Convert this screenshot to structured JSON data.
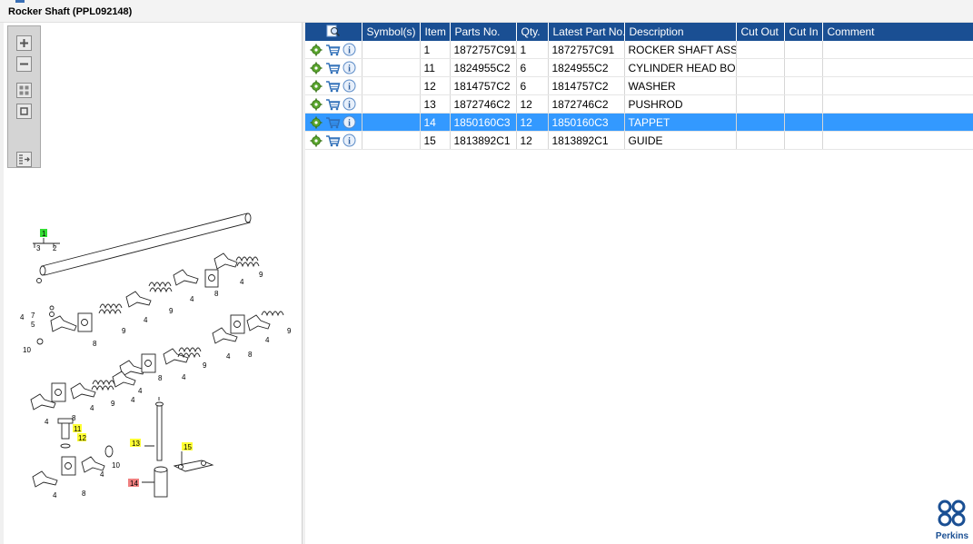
{
  "window": {
    "title": "Rocker Shaft (PPL092148)"
  },
  "viewer_toolbar": {
    "buttons": [
      {
        "icon": "zoom-in-icon"
      },
      {
        "icon": "zoom-out-icon"
      },
      {
        "icon": "fit-page-icon"
      },
      {
        "icon": "actual-size-icon"
      },
      {
        "icon": "export-icon"
      }
    ]
  },
  "diagram": {
    "callouts": {
      "c1": "1",
      "c2": "2",
      "c3": "3",
      "c4": "4",
      "c5": "5",
      "c7": "7",
      "c8": "8",
      "c9": "9",
      "c10": "10",
      "c11": "11",
      "c12": "12",
      "c13": "13",
      "c14": "14",
      "c15": "15"
    },
    "highlight_colors": {
      "selected": "#f08080",
      "item": "#ffff33",
      "group": "#33dd33"
    }
  },
  "table": {
    "headers": [
      "Symbol(s)",
      "Item",
      "Parts No.",
      "Qty.",
      "Latest Part No.",
      "Description",
      "Cut Out",
      "Cut In",
      "Comment"
    ],
    "header_icon": "find-icon",
    "rows": [
      {
        "item": "1",
        "part": "1872757C91",
        "qty": "1",
        "latest": "1872757C91",
        "desc": "ROCKER SHAFT ASSEMBLY",
        "cutout": "",
        "cutin": "",
        "comment": ""
      },
      {
        "item": "11",
        "part": "1824955C2",
        "qty": "6",
        "latest": "1824955C2",
        "desc": "CYLINDER HEAD BOLT",
        "cutout": "",
        "cutin": "",
        "comment": ""
      },
      {
        "item": "12",
        "part": "1814757C2",
        "qty": "6",
        "latest": "1814757C2",
        "desc": "WASHER",
        "cutout": "",
        "cutin": "",
        "comment": ""
      },
      {
        "item": "13",
        "part": "1872746C2",
        "qty": "12",
        "latest": "1872746C2",
        "desc": "PUSHROD",
        "cutout": "",
        "cutin": "",
        "comment": ""
      },
      {
        "item": "14",
        "part": "1850160C3",
        "qty": "12",
        "latest": "1850160C3",
        "desc": "TAPPET",
        "cutout": "",
        "cutin": "",
        "comment": ""
      },
      {
        "item": "15",
        "part": "1813892C1",
        "qty": "12",
        "latest": "1813892C1",
        "desc": "GUIDE",
        "cutout": "",
        "cutin": "",
        "comment": ""
      }
    ],
    "selected_item": "14",
    "row_icons": [
      "gear-icon",
      "cart-icon",
      "info-icon"
    ],
    "header_color": "#1a4f93",
    "selection_color": "#3399ff"
  },
  "logo": {
    "text": "Perkins",
    "symbol": "perkins-logo",
    "color": "#1a4f93"
  }
}
